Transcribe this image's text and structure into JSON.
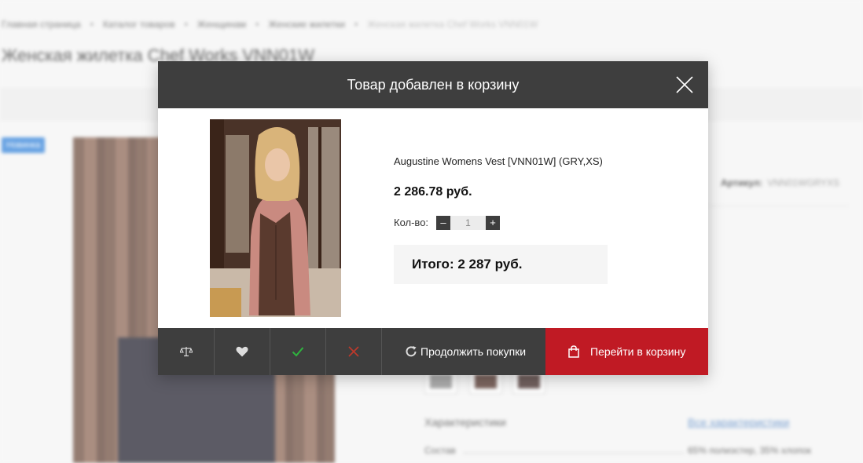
{
  "background": {
    "breadcrumbs": [
      "Главная страница",
      "Каталог товаров",
      "Женщинам",
      "Женские жилетки",
      "Женская жилетка Chef Works VNN01W"
    ],
    "breadcrumb_separator": "•",
    "page_title": "Женская жилетка Chef Works VNN01W",
    "badge": "Новинка",
    "artikul_label": "Артикул:",
    "artikul_value": "VNN01WGRYXS",
    "characteristics_title": "Характеристики",
    "all_characteristics_link": "Все характеристики",
    "composition_label": "Состав",
    "composition_value": "65% полиэстер, 35% хлопок"
  },
  "modal": {
    "title": "Товар добавлен в корзину",
    "close_icon": "close-icon",
    "product": {
      "name": "Augustine Womens Vest [VNN01W] (GRY,XS)",
      "price": "2 286.78 руб.",
      "qty_label": "Кол-во:",
      "qty_value": "1",
      "qty_minus": "–",
      "qty_plus": "+"
    },
    "total": "Итого: 2 287 руб.",
    "footer": {
      "compare_icon": "scales-icon",
      "favorite_icon": "heart-icon",
      "confirm_icon": "check-icon",
      "delete_icon": "cross-icon",
      "continue_label": "Продолжить покупки",
      "cart_label": "Перейти в корзину"
    }
  },
  "colors": {
    "header_bg": "#3e3e3e",
    "cart_red": "#c01a24",
    "check_green": "#2fb43e",
    "cross_red": "#c0392b"
  }
}
